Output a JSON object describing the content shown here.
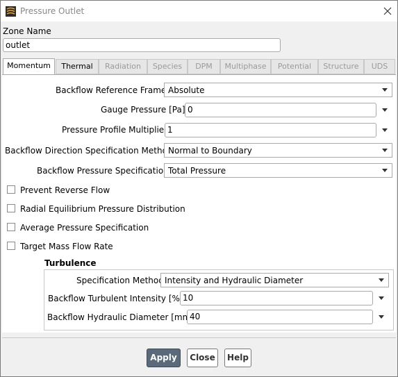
{
  "window": {
    "title": "Pressure Outlet"
  },
  "zone": {
    "label": "Zone Name",
    "value": "outlet"
  },
  "tabs": [
    {
      "label": "Momentum",
      "state": "active"
    },
    {
      "label": "Thermal",
      "state": "enabled"
    },
    {
      "label": "Radiation",
      "state": "disabled"
    },
    {
      "label": "Species",
      "state": "disabled"
    },
    {
      "label": "DPM",
      "state": "disabled"
    },
    {
      "label": "Multiphase",
      "state": "disabled"
    },
    {
      "label": "Potential",
      "state": "disabled"
    },
    {
      "label": "Structure",
      "state": "disabled"
    },
    {
      "label": "UDS",
      "state": "disabled"
    }
  ],
  "momentum": {
    "backflow_reference_frame": {
      "label": "Backflow Reference Frame",
      "value": "Absolute"
    },
    "gauge_pressure": {
      "label": "Gauge Pressure [Pa]",
      "value": "0"
    },
    "pressure_profile_multiplier": {
      "label": "Pressure Profile Multiplier",
      "value": "1"
    },
    "backflow_direction_method": {
      "label": "Backflow Direction Specification Method",
      "value": "Normal to Boundary"
    },
    "backflow_pressure_spec": {
      "label": "Backflow Pressure Specification",
      "value": "Total Pressure"
    },
    "checkboxes": [
      {
        "label": "Prevent Reverse Flow",
        "checked": false
      },
      {
        "label": "Radial Equilibrium Pressure Distribution",
        "checked": false
      },
      {
        "label": "Average Pressure Specification",
        "checked": false
      },
      {
        "label": "Target Mass Flow Rate",
        "checked": false
      }
    ]
  },
  "turbulence": {
    "title": "Turbulence",
    "specification_method": {
      "label": "Specification Method",
      "value": "Intensity and Hydraulic Diameter"
    },
    "intensity": {
      "label": "Backflow Turbulent Intensity [%]",
      "value": "10"
    },
    "hydraulic_diameter": {
      "label": "Backflow Hydraulic Diameter [mm]",
      "value": "40"
    }
  },
  "buttons": {
    "apply": "Apply",
    "close": "Close",
    "help": "Help"
  },
  "colors": {
    "primary_button": "#5a6a7a",
    "panel": "#ffffff",
    "chrome": "#f0f0f0"
  }
}
